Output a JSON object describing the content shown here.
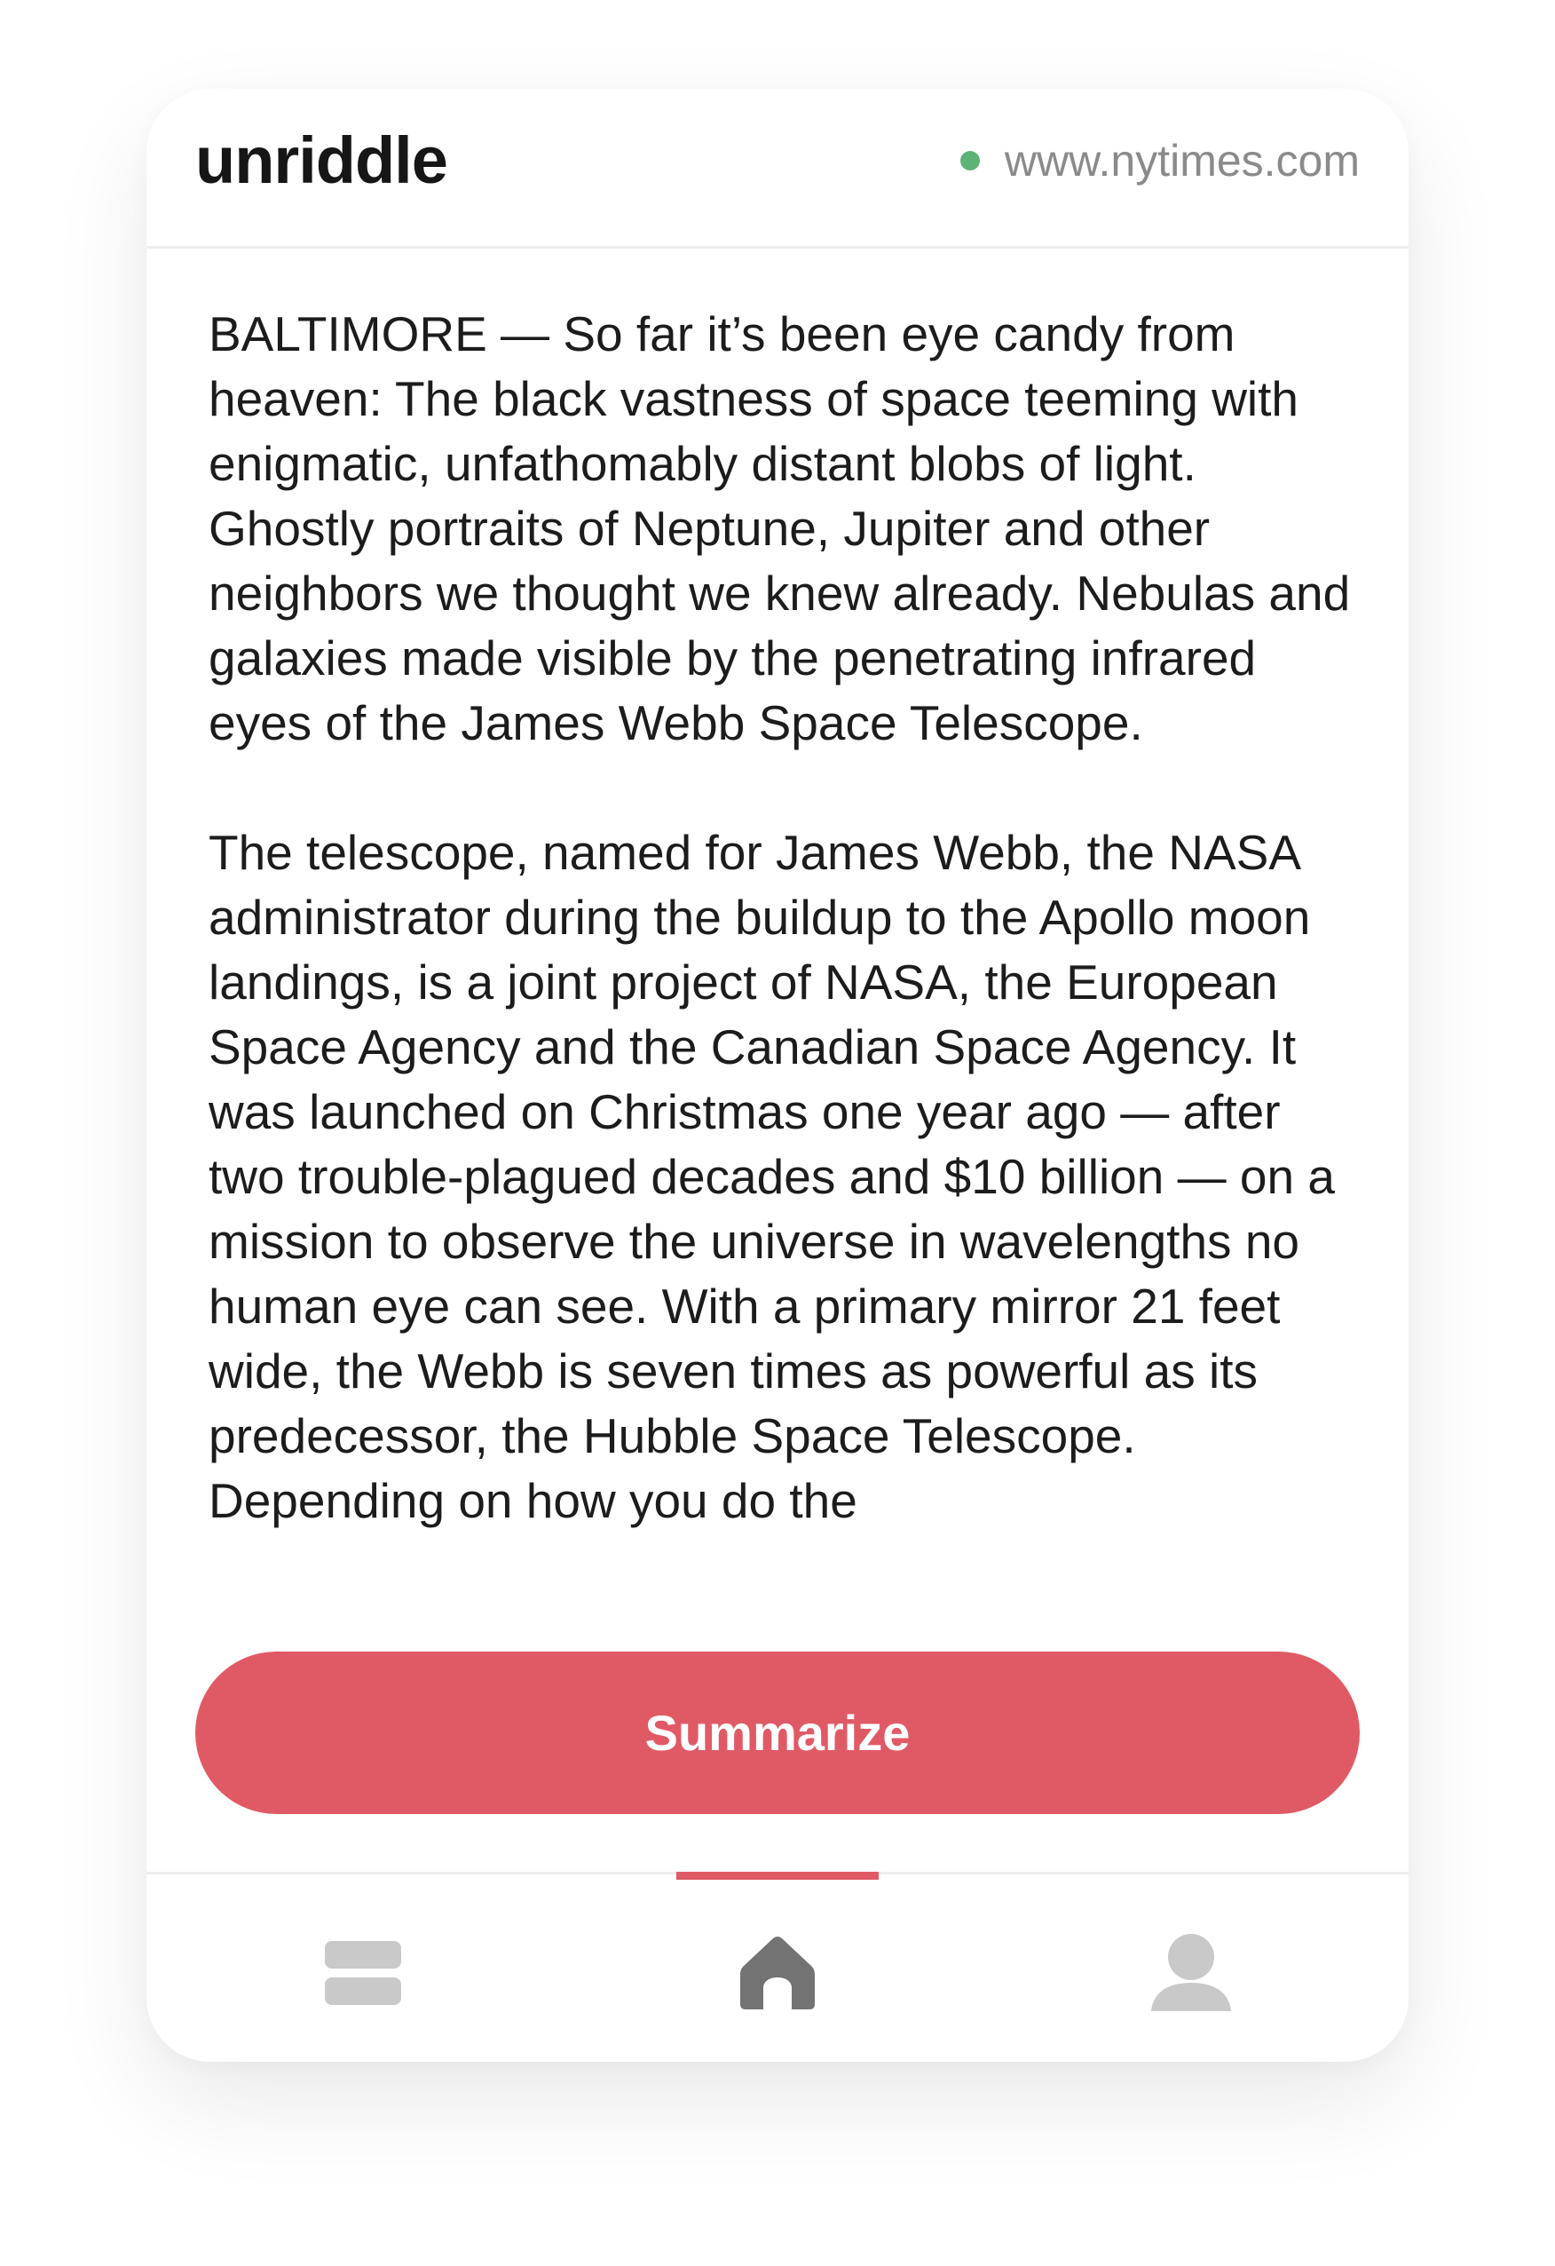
{
  "header": {
    "app_name": "unriddle",
    "site_url": "www.nytimes.com",
    "status_color": "#5db277"
  },
  "article": {
    "paragraphs": [
      "BALTIMORE — So far it’s been eye candy from heaven: The black vastness of space teeming with enigmatic, unfathomably distant blobs of light. Ghostly portraits of Neptune, Jupiter and other neighbors we thought we knew already. Nebulas and galaxies made visible by the penetrating infrared eyes of the James Webb Space Telescope.",
      "The telescope, named for James Webb, the NASA administrator during the buildup to the Apollo moon landings, is a joint project of NASA, the European Space Agency and the Canadian Space Agency. It was launched on Christmas one year ago — after two trouble-plagued decades and $10 billion — on a mission to observe the universe in wavelengths no human eye can see. With a primary mirror 21 feet wide, the Webb is seven times as powerful as its predecessor, the Hubble Space Telescope. Depending on how you do the"
    ]
  },
  "actions": {
    "summarize_label": "Summarize",
    "accent_color": "#e05a66"
  },
  "tabbar": {
    "tabs": [
      {
        "icon": "cards-icon",
        "active": false
      },
      {
        "icon": "home-icon",
        "active": true
      },
      {
        "icon": "profile-icon",
        "active": false
      }
    ]
  }
}
